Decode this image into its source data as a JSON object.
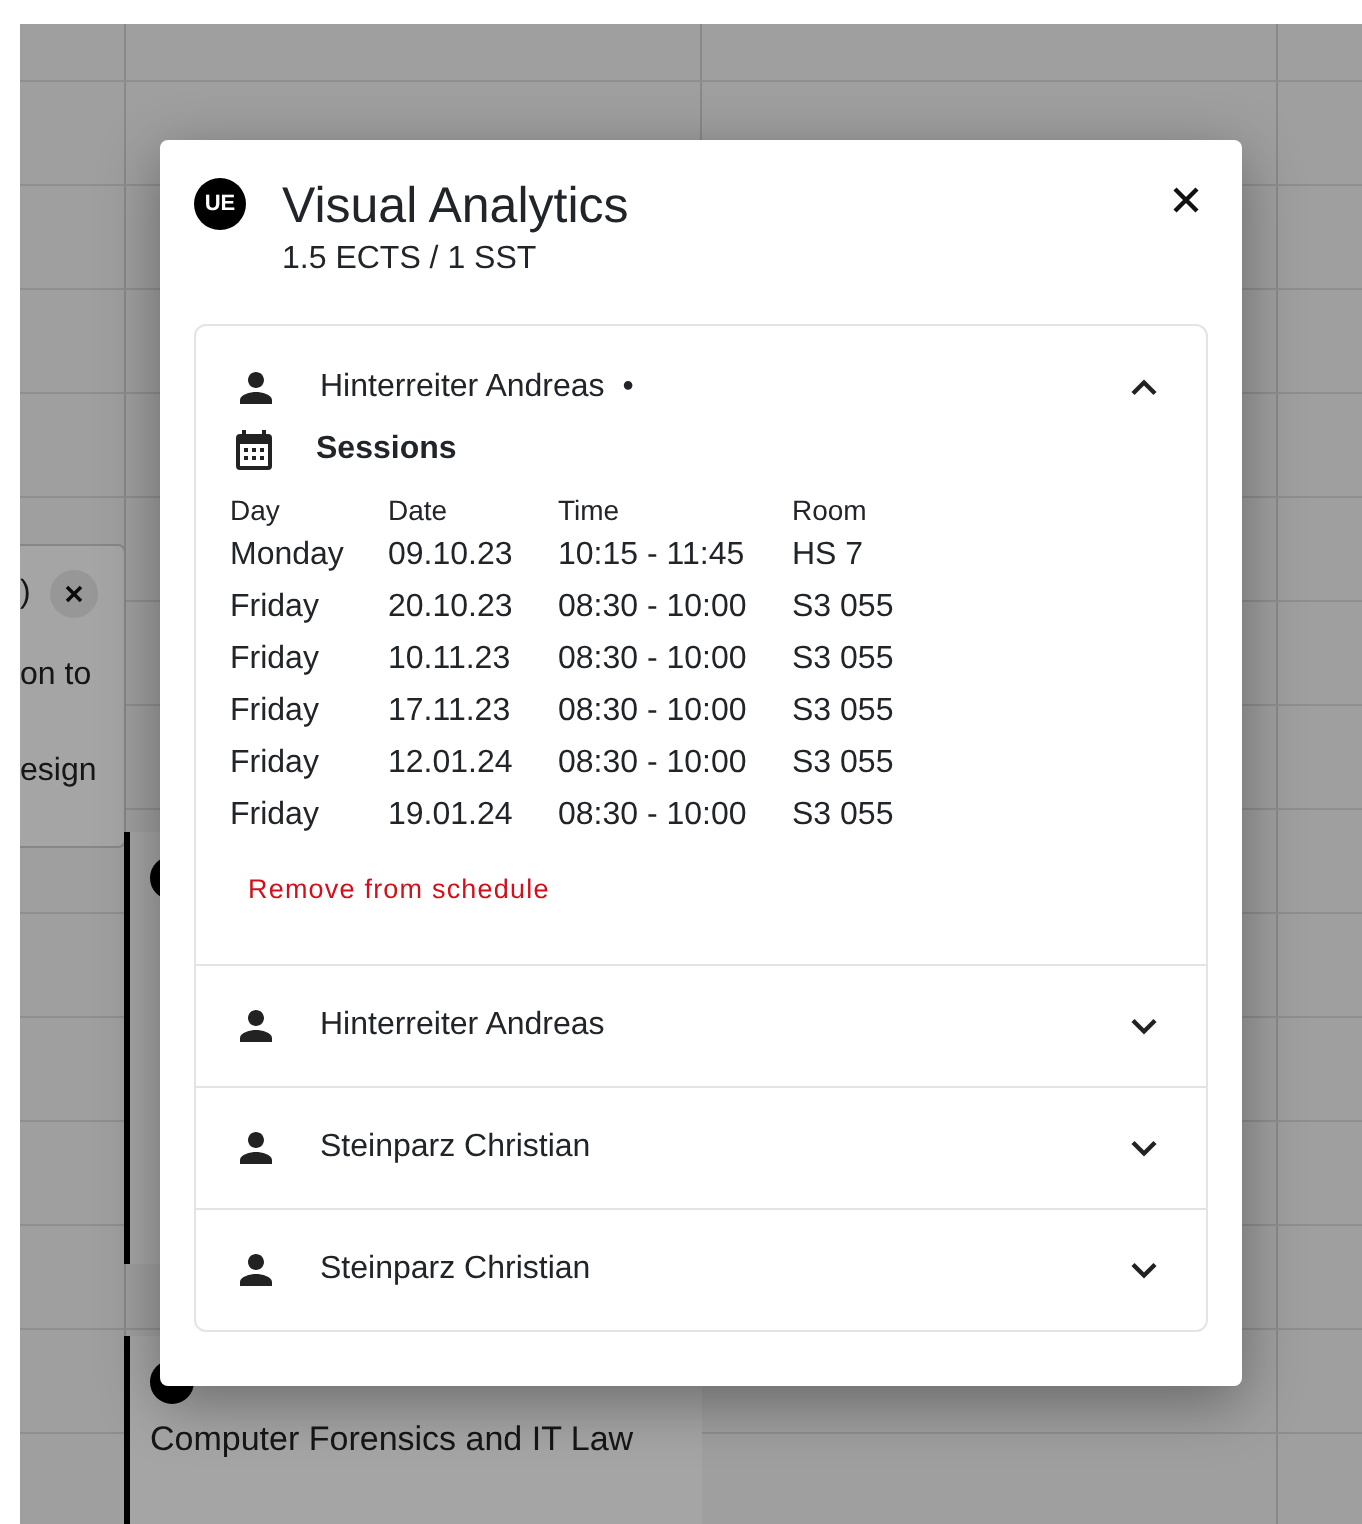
{
  "background": {
    "side_card": {
      "lines": [
        ")",
        "on to",
        "esign"
      ]
    },
    "event_cards": [
      {
        "kind": "event"
      },
      {
        "kind": "event",
        "title": "Computer Forensics and IT Law"
      }
    ]
  },
  "dialog": {
    "badge": "UE",
    "title": "Visual Analytics",
    "subtitle": "1.5 ECTS / 1 SST",
    "lecturers": [
      {
        "name": "Hinterreiter Andreas",
        "marker": "•",
        "expanded": true,
        "sessions": {
          "heading": "Sessions",
          "columns": [
            "Day",
            "Date",
            "Time",
            "Room"
          ],
          "rows": [
            [
              "Monday",
              "09.10.23",
              "10:15 - 11:45",
              "HS 7"
            ],
            [
              "Friday",
              "20.10.23",
              "08:30 - 10:00",
              "S3 055"
            ],
            [
              "Friday",
              "10.11.23",
              "08:30 - 10:00",
              "S3 055"
            ],
            [
              "Friday",
              "17.11.23",
              "08:30 - 10:00",
              "S3 055"
            ],
            [
              "Friday",
              "12.01.24",
              "08:30 - 10:00",
              "S3 055"
            ],
            [
              "Friday",
              "19.01.24",
              "08:30 - 10:00",
              "S3 055"
            ]
          ]
        },
        "action": "Remove from schedule"
      },
      {
        "name": "Hinterreiter Andreas",
        "expanded": false
      },
      {
        "name": "Steinparz Christian",
        "expanded": false
      },
      {
        "name": "Steinparz Christian",
        "expanded": false
      }
    ]
  }
}
